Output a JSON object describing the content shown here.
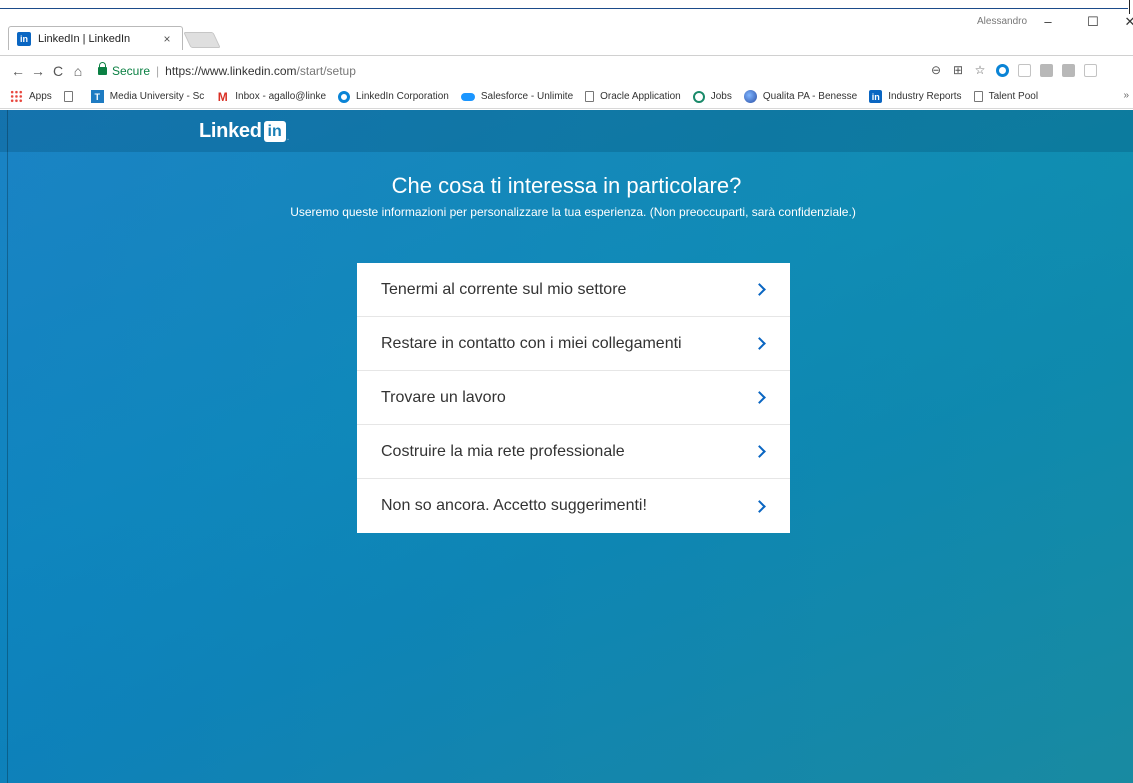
{
  "browser": {
    "tab_title": "LinkedIn | LinkedIn",
    "tab_close": "×",
    "user_name": "Alessandro",
    "window": {
      "minimize": "–",
      "maximize": "☐",
      "close": "✕"
    },
    "secure_label": "Secure",
    "url_host": "https://www.linkedin.com",
    "url_path": "/start/setup",
    "bookmarks": [
      {
        "label": "Apps",
        "icon": "apps-icon"
      },
      {
        "label": "",
        "icon": "page-icon"
      },
      {
        "label": "Media University - Sc",
        "icon": "media-university-icon"
      },
      {
        "label": "Inbox - agallo@linke",
        "icon": "gmail-icon"
      },
      {
        "label": "LinkedIn Corporation",
        "icon": "ring-icon"
      },
      {
        "label": "Salesforce - Unlimite",
        "icon": "salesforce-icon"
      },
      {
        "label": "Oracle Application",
        "icon": "page-icon"
      },
      {
        "label": "Jobs",
        "icon": "chat-icon"
      },
      {
        "label": "Qualita PA - Benesse",
        "icon": "globe-icon"
      },
      {
        "label": "Industry Reports",
        "icon": "linkedin-icon"
      },
      {
        "label": "Talent Pool",
        "icon": "page-icon"
      }
    ],
    "bookmarks_more": "»"
  },
  "header": {
    "logo_text": "Linked",
    "logo_box": "in"
  },
  "main": {
    "title": "Che cosa ti interessa in particolare?",
    "subtitle": "Useremo queste informazioni per personalizzare la tua esperienza. (Non preoccuparti, sarà confidenziale.)",
    "options": [
      "Tenermi al corrente sul mio settore",
      "Restare in contatto con i miei collegamenti",
      "Trovare un lavoro",
      "Costruire la mia rete professionale",
      "Non so ancora. Accetto suggerimenti!"
    ]
  },
  "colors": {
    "accent": "#0a66c2",
    "background_start": "#1d88c4",
    "background_end": "#1a86a8"
  }
}
